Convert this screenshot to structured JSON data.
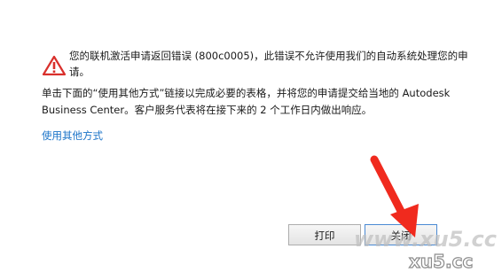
{
  "dialog": {
    "error_line1": "您的联机激活申请返回错误 (800c0005)，此错误不允许使用我们的自动系统处理您的申",
    "error_line2": "请。",
    "instruction_line1": "单击下面的“使用其他方式”链接以完成必要的表格，并将您的申请提交给当地的 Autodesk",
    "instruction_line2": "Business Center。客户服务代表将在接下来的 2 个工作日内做出响应。",
    "alt_method_link": "使用其他方式",
    "print_button": "打印",
    "close_button": "关闭"
  },
  "icons": {
    "warning": "warning-triangle-icon",
    "annotation": "red-arrow"
  },
  "watermark": {
    "text1": "www.xu5.cc",
    "text2": "xu5.cc"
  },
  "colors": {
    "warning_red": "#d9302c",
    "link_blue": "#1a73c8",
    "arrow_red": "#f02a1e",
    "watermark_gray": "#b8b8b8"
  }
}
